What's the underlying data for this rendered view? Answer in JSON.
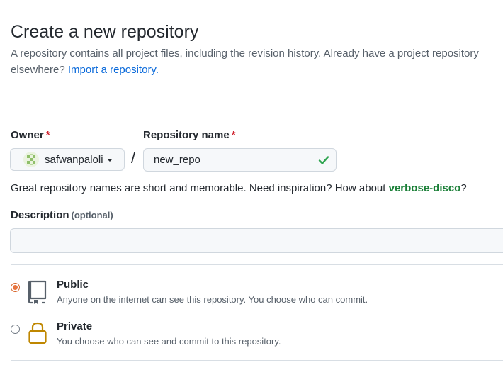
{
  "header": {
    "title": "Create a new repository",
    "subtitle_text": "A repository contains all project files, including the revision history. Already have a project repository elsewhere?",
    "import_link": "Import a repository."
  },
  "owner": {
    "label": "Owner",
    "required_mark": "*",
    "value": "safwanpaloli"
  },
  "separator": "/",
  "repository_name": {
    "label": "Repository name",
    "required_mark": "*",
    "value": "new_repo",
    "valid": true
  },
  "hint": {
    "text": "Great repository names are short and memorable. Need inspiration? How about",
    "suggestion": "verbose-disco",
    "end": "?"
  },
  "description": {
    "label": "Description",
    "optional": "(optional)",
    "value": ""
  },
  "visibility": {
    "selected": "public",
    "options": [
      {
        "id": "public",
        "title": "Public",
        "description": "Anyone on the internet can see this repository. You choose who can commit.",
        "icon": "repo-icon"
      },
      {
        "id": "private",
        "title": "Private",
        "description": "You choose who can see and commit to this repository.",
        "icon": "lock-icon"
      }
    ]
  },
  "colors": {
    "link": "#0969da",
    "success": "#1a7f37",
    "required": "#cf222e",
    "radio_selected": "#e8743f",
    "lock": "#bf8700"
  }
}
